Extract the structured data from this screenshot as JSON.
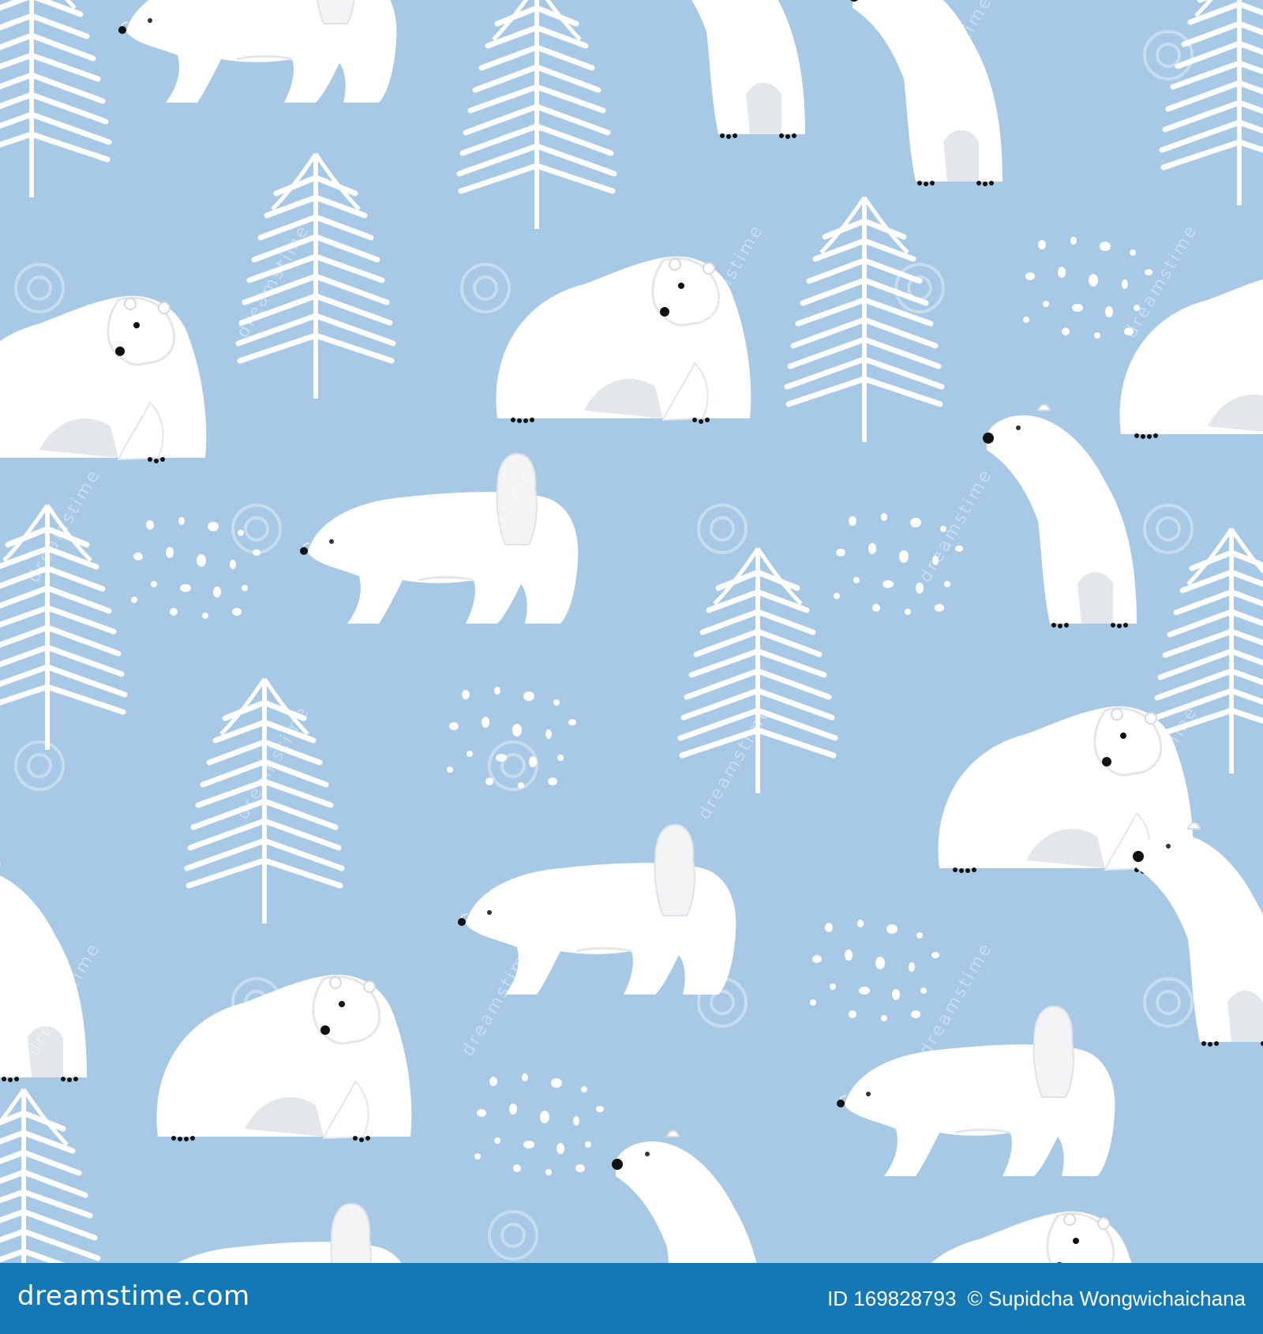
{
  "colors": {
    "background": "#a8c9e6",
    "bear": "#ffffff",
    "bear_shade": "#e3e6ea",
    "tree": "#ffffff",
    "footer": "#1478b4",
    "footer_text": "#ffffff"
  },
  "pattern": {
    "elements": [
      "polar-bear",
      "polar-bear-with-cub",
      "pine-tree",
      "snow-dots"
    ]
  },
  "watermark": {
    "text": "dreamstime"
  },
  "footer": {
    "brand": "dreamstime.com",
    "image_id": "ID 169828793",
    "credit": "© Supidcha Wongwichaichana"
  }
}
